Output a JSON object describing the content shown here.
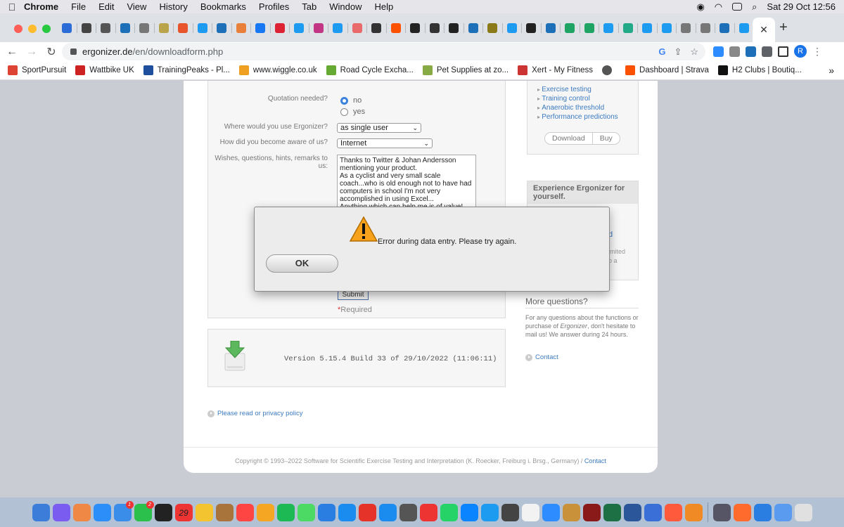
{
  "menubar": {
    "items": [
      "Chrome",
      "File",
      "Edit",
      "View",
      "History",
      "Bookmarks",
      "Profiles",
      "Tab",
      "Window",
      "Help"
    ],
    "clock": "Sat 29 Oct  12:56"
  },
  "tabs": {
    "active_close": "✕",
    "new_tab": "+",
    "favicon_colors": [
      "#2b6cd6",
      "#444",
      "#555",
      "#1d6fb8",
      "#777",
      "#b9a44c",
      "#e8542c",
      "#1d9bf0",
      "#1d6fb8",
      "#e87f3a",
      "#1877f2",
      "#d23",
      "#1d9bf0",
      "#c13584",
      "#1d9bf0",
      "#e86a6a",
      "#333",
      "#fc5200",
      "#222",
      "#333",
      "#222",
      "#1d6fb8",
      "#8a7a1a",
      "#1d9bf0",
      "#222",
      "#1d6fb8",
      "#1fa463",
      "#1fa463",
      "#1d9bf0",
      "#2a8",
      "#1d9bf0",
      "#1d9bf0",
      "#777",
      "#777",
      "#1d6fb8",
      "#1d9bf0"
    ]
  },
  "toolbar": {
    "url_host": "ergonizer.de",
    "url_path": "/en/downloadform.php"
  },
  "bookmarks": [
    {
      "label": "SportPursuit",
      "color": "#d43"
    },
    {
      "label": "Wattbike UK",
      "color": "#c22"
    },
    {
      "label": "TrainingPeaks - Pl...",
      "color": "#1d4f9c"
    },
    {
      "label": "www.wiggle.co.uk",
      "color": "#f0a020"
    },
    {
      "label": "Road Cycle Excha...",
      "color": "#6a3"
    },
    {
      "label": "Pet Supplies at zo...",
      "color": "#8a4"
    },
    {
      "label": "Xert - My Fitness",
      "color": "#c33"
    },
    {
      "label": "",
      "color": "#555"
    },
    {
      "label": "Dashboard | Strava",
      "color": "#fc5200"
    },
    {
      "label": "H2 Clubs | Boutiq...",
      "color": "#111"
    }
  ],
  "form": {
    "quotation_label": "Quotation needed?",
    "quotation_options": [
      "no",
      "yes"
    ],
    "where_label": "Where would you use Ergonizer?",
    "where_value": "as single user",
    "how_label": "How did you become aware of us?",
    "how_value": "Internet",
    "wishes_label": "Wishes, questions, hints, remarks to us:",
    "wishes_value": "Thanks to Twitter & Johan Andersson mentioning your product.\nAs a cyclist and very small scale coach...who is old enough not to have had computers in school I'm not very accomplished in using Excel...\nAnything which can help me is of value!",
    "submit_label": "Submit",
    "required_star": "*",
    "required_label": "Required"
  },
  "version": {
    "text": "Version 5.15.4 Build 33 of 29/10/2022 (11:06:11)"
  },
  "privacy": {
    "label": "Please read or privacy policy"
  },
  "footer": {
    "copyright": "Copyright © 1993–2022 Software for Scientific Exercise Testing and Interpretation (K. Roecker, Freiburg i. Brsg., Germany) / ",
    "contact": "Contact"
  },
  "sidebar": {
    "features": [
      "Exercise testing",
      "Training control",
      "Anaerobic threshold",
      "Performance predictions"
    ],
    "download_label": "Download",
    "buy_label": "Buy",
    "experience_title": "Experience Ergonizer for yourself.",
    "peek_d": "d",
    "peek_imited": "imited",
    "peek_o_a": "o a",
    "more_title": "More questions?",
    "more_text_before": "For any questions about the functions or purchase of ",
    "more_text_em": "Ergonizer",
    "more_text_after": ", don't hesitate to mail us! We answer during 24 hours.",
    "contact_label": "Contact"
  },
  "dialog": {
    "message": "Error during data entry. Please try again.",
    "ok_label": "OK"
  },
  "dock": {
    "date_tile": "29",
    "badges": {
      "mail": "1",
      "messages": "2"
    },
    "colors": [
      "#3b7dd8",
      "#7a5cf0",
      "#e84",
      "#2c8ef8",
      "#3a8de8",
      "#2bbf4b",
      "#222",
      "#e33",
      "#f4c430",
      "#a9743c",
      "#f44",
      "#f5a623",
      "#1db954",
      "#4cd964",
      "#2a7de1",
      "#1a8cf0",
      "#e5332a",
      "#1a8cf0",
      "#555",
      "#e33",
      "#25d366",
      "#0a84ff",
      "#1d9bf0",
      "#444",
      "#f2f2f2",
      "#2d8cff",
      "#c9923a",
      "#8a1a1a",
      "#1d7044",
      "#2b579a",
      "#3a6fd8",
      "#ff5a3c",
      "#f08a24",
      "#556",
      "#ff6b2d",
      "#2a7de1",
      "#5a9bf0",
      "#e0e0e0"
    ]
  }
}
